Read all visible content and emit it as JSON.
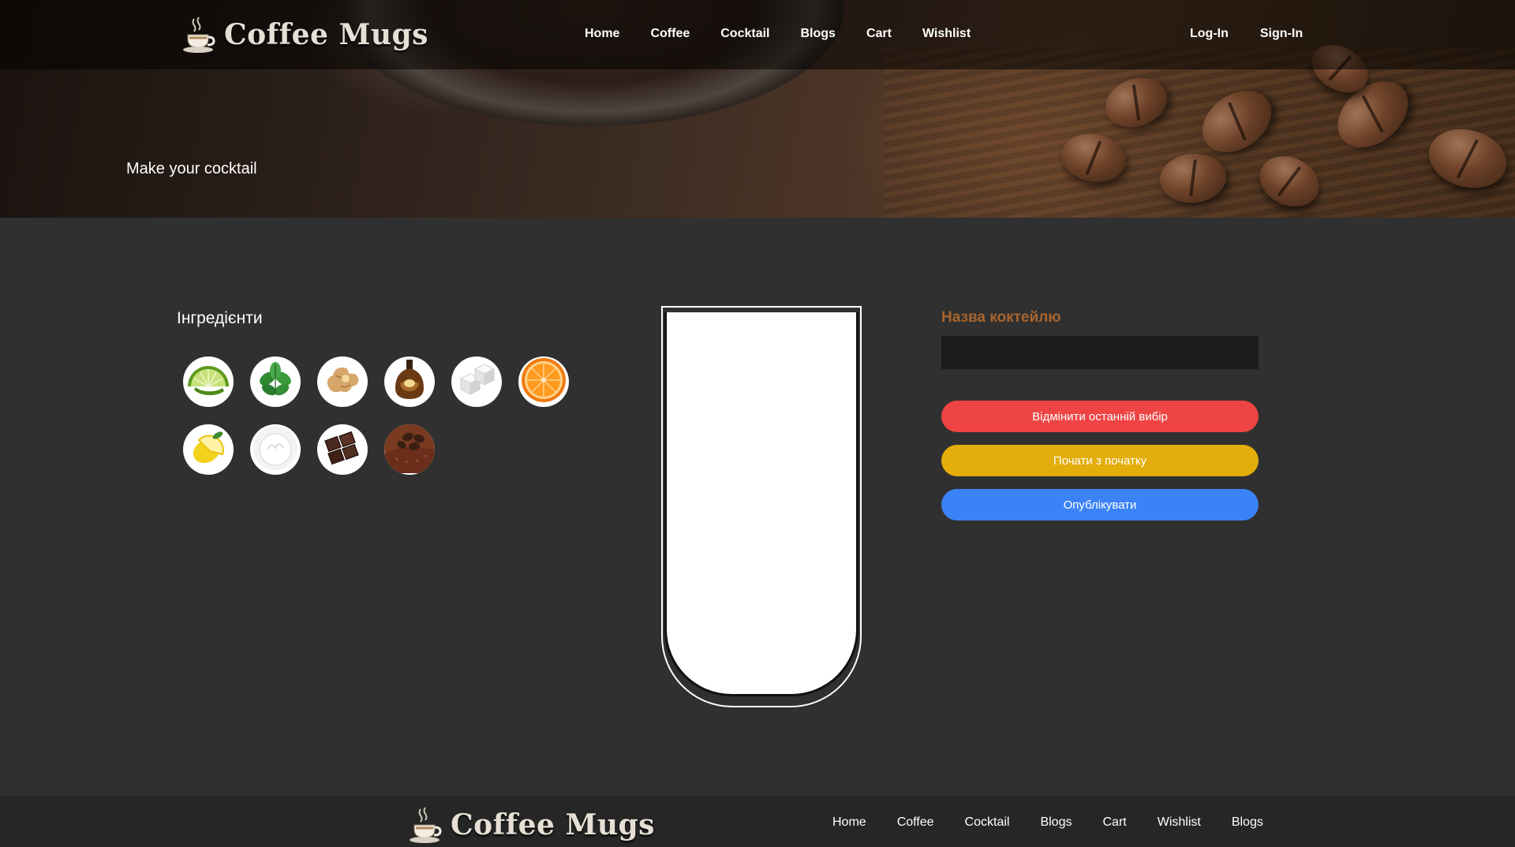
{
  "brand": {
    "name": "Coffee Mugs",
    "icon": "coffee-cup-icon"
  },
  "nav": {
    "links": [
      "Home",
      "Coffee",
      "Cocktail",
      "Blogs",
      "Cart",
      "Wishlist"
    ],
    "auth": [
      "Log-In",
      "Sign-In"
    ]
  },
  "hero": {
    "title": "Make your cocktail"
  },
  "ingredients": {
    "title": "Інгредієнти",
    "items": [
      {
        "icon": "lime-icon"
      },
      {
        "icon": "mint-icon"
      },
      {
        "icon": "ginger-icon"
      },
      {
        "icon": "liqueur-bottle-icon"
      },
      {
        "icon": "sugar-cube-icon"
      },
      {
        "icon": "orange-icon"
      },
      {
        "icon": "lemon-icon"
      },
      {
        "icon": "whipped-cream-icon"
      },
      {
        "icon": "chocolate-icon"
      },
      {
        "icon": "coffee-beans-icon"
      }
    ]
  },
  "form": {
    "name_label": "Назва коктейлю",
    "name_value": "",
    "undo_label": "Відмінити останній вибір",
    "reset_label": "Почати з початку",
    "publish_label": "Опублікувати"
  },
  "footer": {
    "links": [
      "Home",
      "Coffee",
      "Cocktail",
      "Blogs",
      "Cart",
      "Wishlist",
      "Blogs"
    ]
  },
  "colors": {
    "background": "#303030",
    "label_accent": "#a8642d",
    "undo": "#ef4444",
    "reset": "#e3ad0c",
    "publish": "#3b82f6"
  }
}
